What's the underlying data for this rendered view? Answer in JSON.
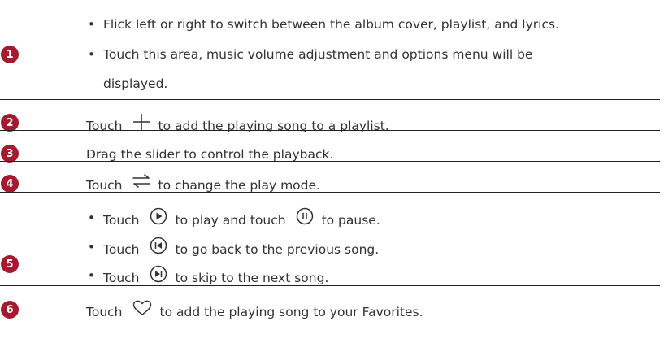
{
  "rows": [
    {
      "number": "1",
      "bullets": [
        "Flick left or right to switch between the album cover, playlist, and lyrics.",
        "Touch this area, music volume adjustment and options menu will be",
        "displayed."
      ]
    },
    {
      "number": "2",
      "before": "Touch",
      "icon": "plus-icon",
      "after": "to add the playing song to a playlist."
    },
    {
      "number": "3",
      "text": "Drag the slider to control the playback."
    },
    {
      "number": "4",
      "before": "Touch",
      "icon": "play-mode-icon",
      "after": "to change the play mode."
    },
    {
      "number": "5",
      "bullets": [
        {
          "before": "Touch",
          "icon": "play-icon",
          "middle": "to play and touch",
          "icon2": "pause-icon",
          "after": "to pause."
        },
        {
          "before": "Touch",
          "icon": "previous-icon",
          "after": "to go back to the previous song."
        },
        {
          "before": "Touch",
          "icon": "next-icon",
          "after": "to skip to the next song."
        }
      ]
    },
    {
      "number": "6",
      "before": "Touch",
      "icon": "heart-icon",
      "after": "to add the playing song to your Favorites."
    }
  ],
  "colors": {
    "badge": "#a6192e",
    "text": "#333333",
    "rule": "#222222"
  }
}
